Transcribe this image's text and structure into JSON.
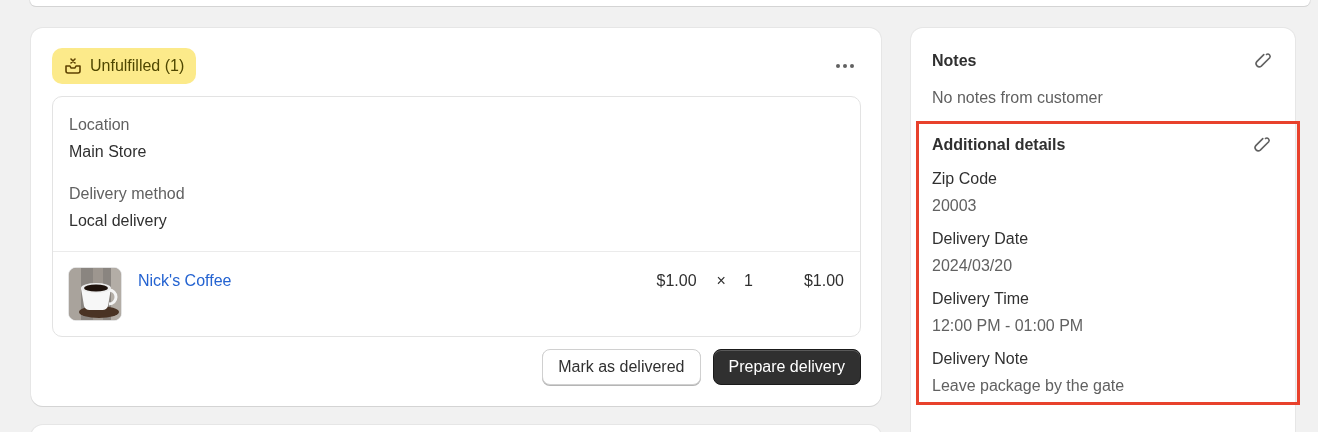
{
  "fulfillment": {
    "status": {
      "label": "Unfulfilled (1)",
      "kind": "unfulfilled"
    },
    "fields": [
      {
        "label": "Location",
        "value": "Main Store"
      },
      {
        "label": "Delivery method",
        "value": "Local delivery"
      }
    ],
    "items": [
      {
        "kind": "picture",
        "name": "Nick's Coffee",
        "price": "$1.00",
        "times": "×",
        "quantity": "1",
        "total": "$1.00"
      }
    ],
    "buttons": [
      {
        "label": "Mark as delivered",
        "kind": "secondary"
      },
      {
        "label": "Prepare delivery",
        "kind": "primary"
      }
    ]
  },
  "notes": {
    "title": "Notes",
    "text": "No notes from customer"
  },
  "additional_details": {
    "title": "Additional details",
    "highlighted": true,
    "fields": [
      {
        "label": "Zip Code",
        "value": "20003"
      },
      {
        "label": "Delivery Date",
        "value": "2024/03/20"
      },
      {
        "label": "Delivery Time",
        "value": "12:00 PM - 01:00 PM"
      },
      {
        "label": "Delivery Note",
        "value": "Leave package by the gate"
      }
    ]
  }
}
